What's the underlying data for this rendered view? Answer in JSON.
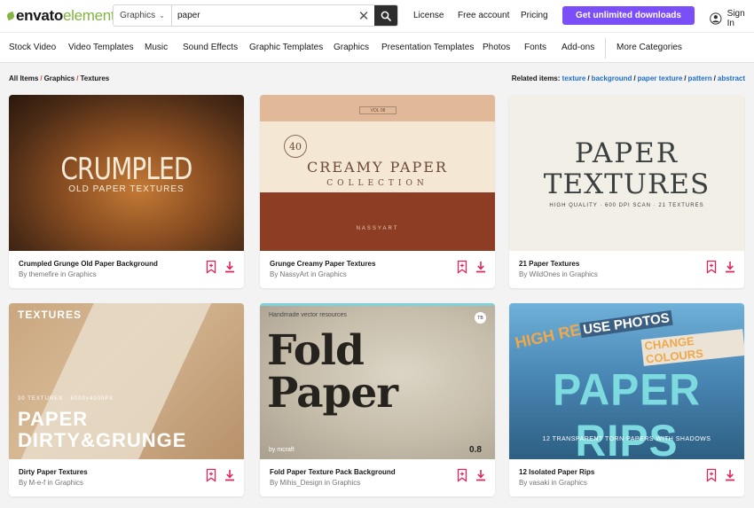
{
  "header": {
    "logo_primary": "envato",
    "logo_secondary": "elements",
    "search_category": "Graphics",
    "search_value": "paper",
    "links": [
      "License",
      "Free account",
      "Pricing"
    ],
    "cta_label": "Get unlimited downloads",
    "signin_label": "Sign In"
  },
  "nav": {
    "items": [
      "Stock Video",
      "Video Templates",
      "Music",
      "Sound Effects",
      "Graphic Templates",
      "Graphics",
      "Presentation Templates",
      "Photos",
      "Fonts",
      "Add-ons",
      "More Categories"
    ]
  },
  "breadcrumb": [
    "All Items",
    "Graphics",
    "Textures"
  ],
  "related": {
    "label": "Related items:",
    "items": [
      "texture",
      "background",
      "paper texture",
      "pattern",
      "abstract"
    ]
  },
  "cards": [
    {
      "title": "Crumpled Grunge Old Paper Background",
      "byline": "By themefire in Graphics",
      "thumb": {
        "line1": "CRUMPLED",
        "line2": "OLD PAPER TEXTURES"
      }
    },
    {
      "title": "Grunge Creamy Paper Textures",
      "byline": "By NassyArt in Graphics",
      "thumb": {
        "tag": "VOL 08",
        "number": "40",
        "line1": "CREAMY PAPER",
        "line2": "COLLECTION",
        "author": "NASSYART"
      }
    },
    {
      "title": "21 Paper Textures",
      "byline": "By WildOnes in Graphics",
      "thumb": {
        "line1": "PAPER",
        "line2": "TEXTURES",
        "line3": "HIGH QUALITY · 600 DPI SCAN · 21 TEXTURES"
      }
    },
    {
      "title": "Dirty Paper Textures",
      "byline": "By M-e-f in Graphics",
      "thumb": {
        "top": "TEXTURES",
        "sub": "30 TEXTURES · 6000x4000PX",
        "line1": "PAPER",
        "line2": "DIRTY&GRUNGE"
      }
    },
    {
      "title": "Fold Paper Texture Pack Background",
      "byline": "By Mihis_Design in Graphics",
      "thumb": {
        "top": "Handmade vector resources",
        "line1": "Fold",
        "line2": "Paper",
        "author": "by mcraft",
        "badge": "0.8"
      }
    },
    {
      "title": "12 Isolated Paper Rips",
      "byline": "By vasaki in Graphics",
      "thumb": {
        "tag1": "HIGH RES",
        "tag2": "USE PHOTOS",
        "tag3": "CHANGE COLOURS",
        "line1": "PAPER RIPS",
        "line2": "12 TRANSPARENT TORN PAPERS WITH SHADOWS"
      }
    }
  ],
  "colors": {
    "accent": "#7b4ff7",
    "brand_green": "#82b541",
    "action_pink": "#e3245c",
    "link_blue": "#1e6ec6"
  },
  "icons": {
    "card_bookmark": "bookmark-add-icon",
    "card_download": "download-icon",
    "search": "search-icon",
    "clear": "close-icon",
    "user": "user-icon"
  }
}
